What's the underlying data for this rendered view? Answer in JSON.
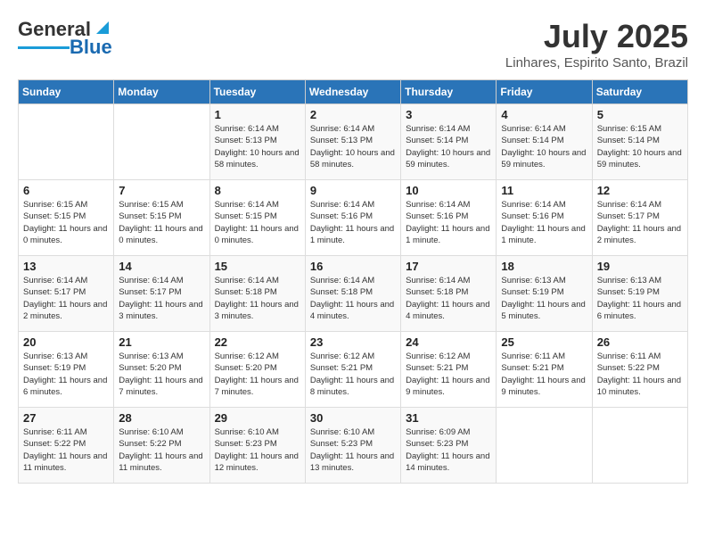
{
  "header": {
    "logo_general": "General",
    "logo_blue": "Blue",
    "month_title": "July 2025",
    "subtitle": "Linhares, Espirito Santo, Brazil"
  },
  "days_of_week": [
    "Sunday",
    "Monday",
    "Tuesday",
    "Wednesday",
    "Thursday",
    "Friday",
    "Saturday"
  ],
  "weeks": [
    [
      {
        "day": "",
        "sunrise": "",
        "sunset": "",
        "daylight": ""
      },
      {
        "day": "",
        "sunrise": "",
        "sunset": "",
        "daylight": ""
      },
      {
        "day": "1",
        "sunrise": "Sunrise: 6:14 AM",
        "sunset": "Sunset: 5:13 PM",
        "daylight": "Daylight: 10 hours and 58 minutes."
      },
      {
        "day": "2",
        "sunrise": "Sunrise: 6:14 AM",
        "sunset": "Sunset: 5:13 PM",
        "daylight": "Daylight: 10 hours and 58 minutes."
      },
      {
        "day": "3",
        "sunrise": "Sunrise: 6:14 AM",
        "sunset": "Sunset: 5:14 PM",
        "daylight": "Daylight: 10 hours and 59 minutes."
      },
      {
        "day": "4",
        "sunrise": "Sunrise: 6:14 AM",
        "sunset": "Sunset: 5:14 PM",
        "daylight": "Daylight: 10 hours and 59 minutes."
      },
      {
        "day": "5",
        "sunrise": "Sunrise: 6:15 AM",
        "sunset": "Sunset: 5:14 PM",
        "daylight": "Daylight: 10 hours and 59 minutes."
      }
    ],
    [
      {
        "day": "6",
        "sunrise": "Sunrise: 6:15 AM",
        "sunset": "Sunset: 5:15 PM",
        "daylight": "Daylight: 11 hours and 0 minutes."
      },
      {
        "day": "7",
        "sunrise": "Sunrise: 6:15 AM",
        "sunset": "Sunset: 5:15 PM",
        "daylight": "Daylight: 11 hours and 0 minutes."
      },
      {
        "day": "8",
        "sunrise": "Sunrise: 6:14 AM",
        "sunset": "Sunset: 5:15 PM",
        "daylight": "Daylight: 11 hours and 0 minutes."
      },
      {
        "day": "9",
        "sunrise": "Sunrise: 6:14 AM",
        "sunset": "Sunset: 5:16 PM",
        "daylight": "Daylight: 11 hours and 1 minute."
      },
      {
        "day": "10",
        "sunrise": "Sunrise: 6:14 AM",
        "sunset": "Sunset: 5:16 PM",
        "daylight": "Daylight: 11 hours and 1 minute."
      },
      {
        "day": "11",
        "sunrise": "Sunrise: 6:14 AM",
        "sunset": "Sunset: 5:16 PM",
        "daylight": "Daylight: 11 hours and 1 minute."
      },
      {
        "day": "12",
        "sunrise": "Sunrise: 6:14 AM",
        "sunset": "Sunset: 5:17 PM",
        "daylight": "Daylight: 11 hours and 2 minutes."
      }
    ],
    [
      {
        "day": "13",
        "sunrise": "Sunrise: 6:14 AM",
        "sunset": "Sunset: 5:17 PM",
        "daylight": "Daylight: 11 hours and 2 minutes."
      },
      {
        "day": "14",
        "sunrise": "Sunrise: 6:14 AM",
        "sunset": "Sunset: 5:17 PM",
        "daylight": "Daylight: 11 hours and 3 minutes."
      },
      {
        "day": "15",
        "sunrise": "Sunrise: 6:14 AM",
        "sunset": "Sunset: 5:18 PM",
        "daylight": "Daylight: 11 hours and 3 minutes."
      },
      {
        "day": "16",
        "sunrise": "Sunrise: 6:14 AM",
        "sunset": "Sunset: 5:18 PM",
        "daylight": "Daylight: 11 hours and 4 minutes."
      },
      {
        "day": "17",
        "sunrise": "Sunrise: 6:14 AM",
        "sunset": "Sunset: 5:18 PM",
        "daylight": "Daylight: 11 hours and 4 minutes."
      },
      {
        "day": "18",
        "sunrise": "Sunrise: 6:13 AM",
        "sunset": "Sunset: 5:19 PM",
        "daylight": "Daylight: 11 hours and 5 minutes."
      },
      {
        "day": "19",
        "sunrise": "Sunrise: 6:13 AM",
        "sunset": "Sunset: 5:19 PM",
        "daylight": "Daylight: 11 hours and 6 minutes."
      }
    ],
    [
      {
        "day": "20",
        "sunrise": "Sunrise: 6:13 AM",
        "sunset": "Sunset: 5:19 PM",
        "daylight": "Daylight: 11 hours and 6 minutes."
      },
      {
        "day": "21",
        "sunrise": "Sunrise: 6:13 AM",
        "sunset": "Sunset: 5:20 PM",
        "daylight": "Daylight: 11 hours and 7 minutes."
      },
      {
        "day": "22",
        "sunrise": "Sunrise: 6:12 AM",
        "sunset": "Sunset: 5:20 PM",
        "daylight": "Daylight: 11 hours and 7 minutes."
      },
      {
        "day": "23",
        "sunrise": "Sunrise: 6:12 AM",
        "sunset": "Sunset: 5:21 PM",
        "daylight": "Daylight: 11 hours and 8 minutes."
      },
      {
        "day": "24",
        "sunrise": "Sunrise: 6:12 AM",
        "sunset": "Sunset: 5:21 PM",
        "daylight": "Daylight: 11 hours and 9 minutes."
      },
      {
        "day": "25",
        "sunrise": "Sunrise: 6:11 AM",
        "sunset": "Sunset: 5:21 PM",
        "daylight": "Daylight: 11 hours and 9 minutes."
      },
      {
        "day": "26",
        "sunrise": "Sunrise: 6:11 AM",
        "sunset": "Sunset: 5:22 PM",
        "daylight": "Daylight: 11 hours and 10 minutes."
      }
    ],
    [
      {
        "day": "27",
        "sunrise": "Sunrise: 6:11 AM",
        "sunset": "Sunset: 5:22 PM",
        "daylight": "Daylight: 11 hours and 11 minutes."
      },
      {
        "day": "28",
        "sunrise": "Sunrise: 6:10 AM",
        "sunset": "Sunset: 5:22 PM",
        "daylight": "Daylight: 11 hours and 11 minutes."
      },
      {
        "day": "29",
        "sunrise": "Sunrise: 6:10 AM",
        "sunset": "Sunset: 5:23 PM",
        "daylight": "Daylight: 11 hours and 12 minutes."
      },
      {
        "day": "30",
        "sunrise": "Sunrise: 6:10 AM",
        "sunset": "Sunset: 5:23 PM",
        "daylight": "Daylight: 11 hours and 13 minutes."
      },
      {
        "day": "31",
        "sunrise": "Sunrise: 6:09 AM",
        "sunset": "Sunset: 5:23 PM",
        "daylight": "Daylight: 11 hours and 14 minutes."
      },
      {
        "day": "",
        "sunrise": "",
        "sunset": "",
        "daylight": ""
      },
      {
        "day": "",
        "sunrise": "",
        "sunset": "",
        "daylight": ""
      }
    ]
  ]
}
